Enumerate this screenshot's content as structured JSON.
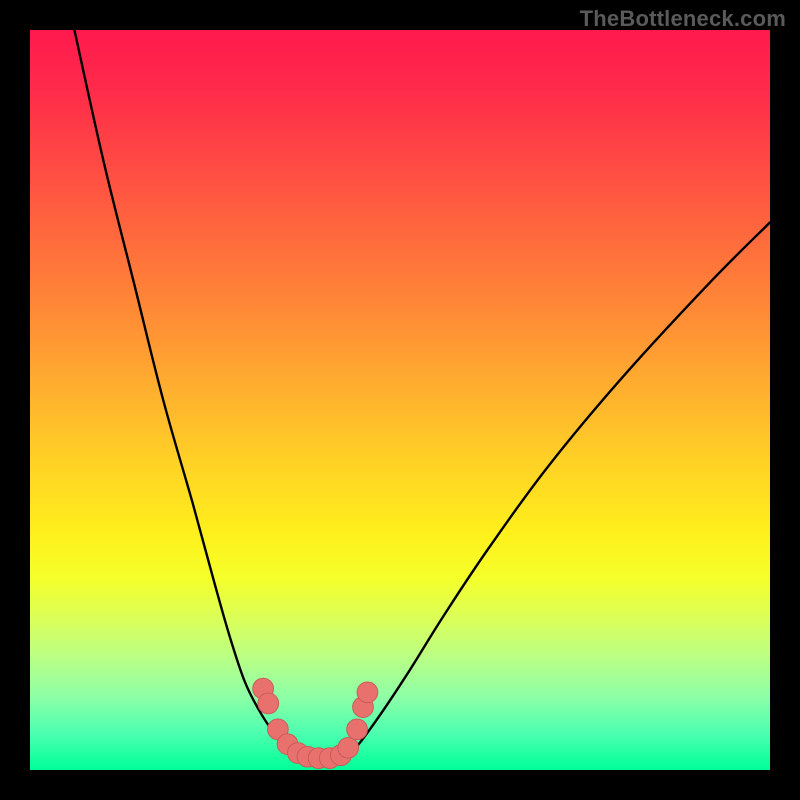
{
  "watermark": "TheBottleneck.com",
  "colors": {
    "frame": "#000000",
    "curve": "#000000",
    "marker_fill": "#e8716e",
    "marker_stroke": "#c95c59"
  },
  "chart_data": {
    "type": "line",
    "title": "",
    "xlabel": "",
    "ylabel": "",
    "xlim": [
      0,
      100
    ],
    "ylim": [
      0,
      100
    ],
    "grid": false,
    "series": [
      {
        "name": "left-curve",
        "x": [
          6,
          10,
          14,
          18,
          22,
          25,
          27,
          29,
          31,
          33,
          35,
          36,
          37
        ],
        "y": [
          100,
          82,
          66,
          50,
          36,
          25,
          18,
          12,
          8,
          5,
          3,
          2,
          1.5
        ]
      },
      {
        "name": "right-curve",
        "x": [
          42,
          44,
          47,
          51,
          56,
          62,
          70,
          80,
          92,
          100
        ],
        "y": [
          1.5,
          3,
          7,
          13,
          21,
          30,
          41,
          53,
          66,
          74
        ]
      }
    ],
    "markers": {
      "name": "bottom-markers",
      "points": [
        {
          "x": 31.5,
          "y": 11
        },
        {
          "x": 32.2,
          "y": 9
        },
        {
          "x": 33.5,
          "y": 5.5
        },
        {
          "x": 34.8,
          "y": 3.5
        },
        {
          "x": 36.2,
          "y": 2.3
        },
        {
          "x": 37.5,
          "y": 1.8
        },
        {
          "x": 39.0,
          "y": 1.6
        },
        {
          "x": 40.5,
          "y": 1.6
        },
        {
          "x": 42.0,
          "y": 2.0
        },
        {
          "x": 43.0,
          "y": 3.0
        },
        {
          "x": 44.2,
          "y": 5.5
        },
        {
          "x": 45.0,
          "y": 8.5
        },
        {
          "x": 45.6,
          "y": 10.5
        }
      ],
      "radius_pct": 1.4
    }
  }
}
